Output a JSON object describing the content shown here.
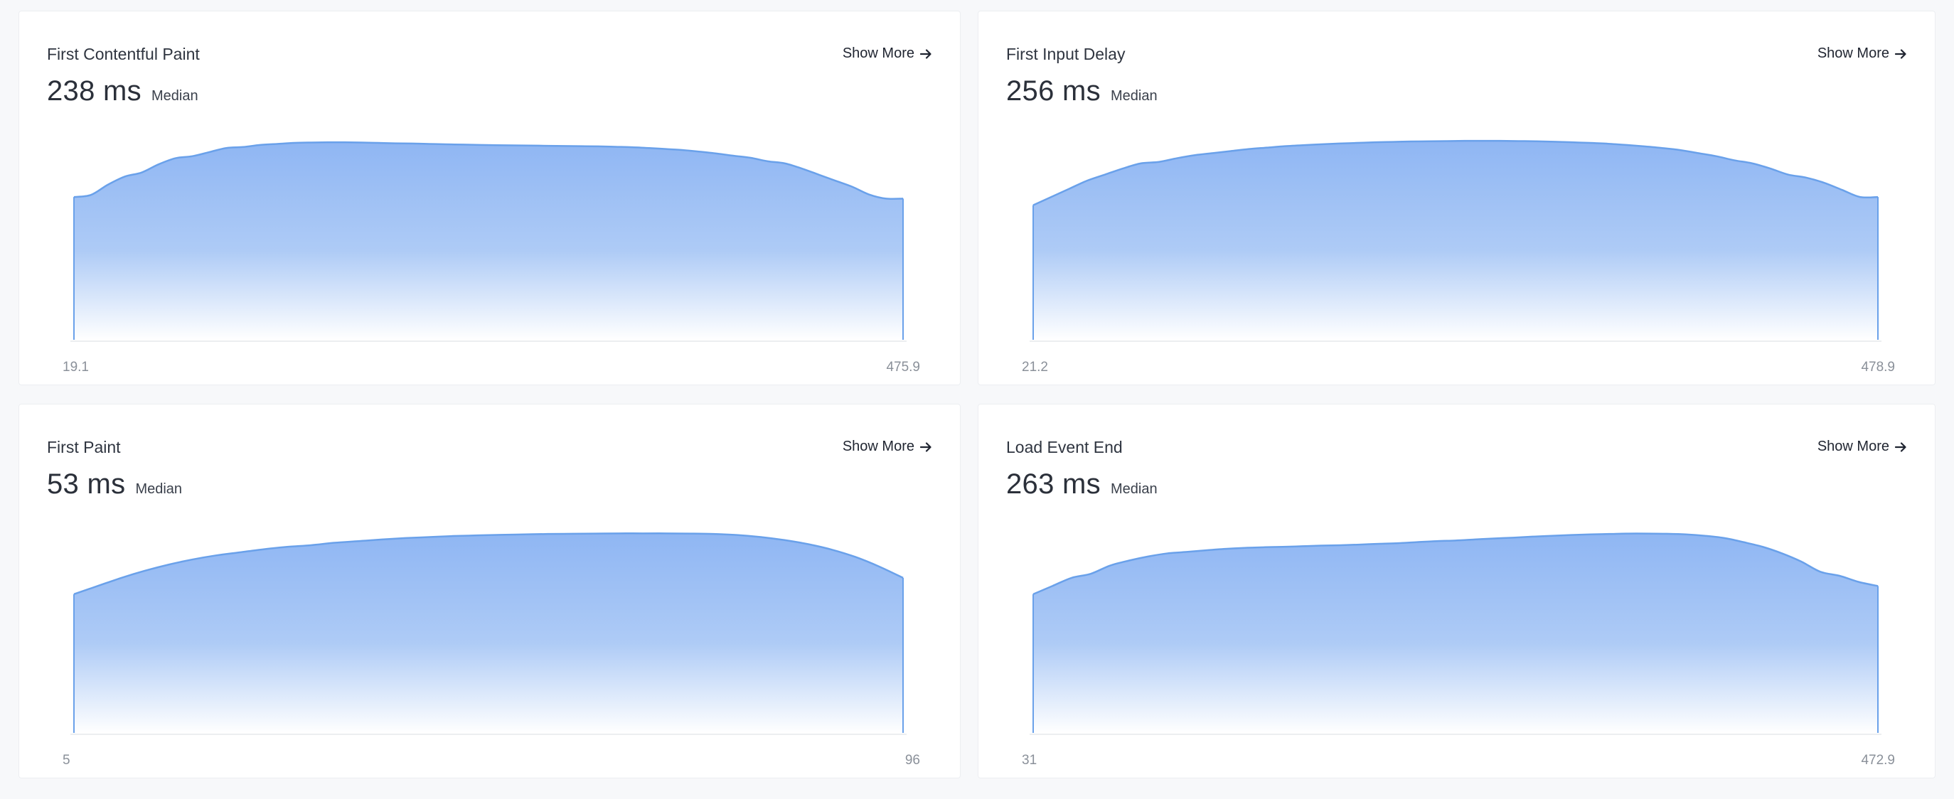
{
  "cards": [
    {
      "title": "First Contentful Paint",
      "show_more": "Show More",
      "value": "238 ms",
      "value_label": "Median",
      "chart_data": {
        "type": "area",
        "x_range": [
          "19.1",
          "475.9"
        ],
        "color": "#6aa1ea",
        "y": [
          0.7,
          0.71,
          0.76,
          0.8,
          0.82,
          0.86,
          0.89,
          0.9,
          0.92,
          0.94,
          0.945,
          0.955,
          0.96,
          0.965,
          0.967,
          0.968,
          0.968,
          0.967,
          0.965,
          0.963,
          0.962,
          0.96,
          0.958,
          0.957,
          0.955,
          0.954,
          0.953,
          0.952,
          0.951,
          0.95,
          0.949,
          0.948,
          0.946,
          0.944,
          0.94,
          0.935,
          0.93,
          0.922,
          0.913,
          0.902,
          0.892,
          0.875,
          0.865,
          0.84,
          0.81,
          0.78,
          0.75,
          0.712,
          0.692,
          0.692
        ]
      }
    },
    {
      "title": "First Input Delay",
      "show_more": "Show More",
      "value": "256 ms",
      "value_label": "Median",
      "chart_data": {
        "type": "area",
        "x_range": [
          "21.2",
          "478.9"
        ],
        "color": "#6aa1ea",
        "y": [
          0.66,
          0.7,
          0.74,
          0.78,
          0.81,
          0.84,
          0.865,
          0.872,
          0.89,
          0.905,
          0.915,
          0.925,
          0.935,
          0.942,
          0.949,
          0.954,
          0.958,
          0.962,
          0.965,
          0.968,
          0.97,
          0.972,
          0.973,
          0.974,
          0.975,
          0.975,
          0.975,
          0.974,
          0.973,
          0.971,
          0.968,
          0.965,
          0.961,
          0.955,
          0.948,
          0.94,
          0.93,
          0.915,
          0.9,
          0.88,
          0.865,
          0.84,
          0.81,
          0.795,
          0.77,
          0.735,
          0.7,
          0.7
        ]
      }
    },
    {
      "title": "First Paint",
      "show_more": "Show More",
      "value": "53 ms",
      "value_label": "Median",
      "chart_data": {
        "type": "area",
        "x_range": [
          "5",
          "96"
        ],
        "color": "#6aa1ea",
        "y": [
          0.68,
          0.72,
          0.76,
          0.795,
          0.825,
          0.85,
          0.87,
          0.885,
          0.9,
          0.912,
          0.92,
          0.932,
          0.94,
          0.948,
          0.955,
          0.96,
          0.965,
          0.968,
          0.971,
          0.973,
          0.975,
          0.976,
          0.977,
          0.978,
          0.978,
          0.978,
          0.977,
          0.975,
          0.97,
          0.96,
          0.945,
          0.925,
          0.898,
          0.862,
          0.815,
          0.76
        ]
      }
    },
    {
      "title": "Load Event End",
      "show_more": "Show More",
      "value": "263 ms",
      "value_label": "Median",
      "chart_data": {
        "type": "area",
        "x_range": [
          "31",
          "472.9"
        ],
        "color": "#6aa1ea",
        "y": [
          0.68,
          0.72,
          0.76,
          0.78,
          0.82,
          0.845,
          0.865,
          0.88,
          0.887,
          0.895,
          0.902,
          0.907,
          0.91,
          0.912,
          0.915,
          0.918,
          0.92,
          0.923,
          0.927,
          0.93,
          0.935,
          0.94,
          0.943,
          0.948,
          0.953,
          0.957,
          0.962,
          0.966,
          0.97,
          0.973,
          0.975,
          0.977,
          0.977,
          0.976,
          0.973,
          0.966,
          0.955,
          0.935,
          0.912,
          0.88,
          0.84,
          0.79,
          0.77,
          0.74,
          0.72
        ]
      }
    }
  ]
}
